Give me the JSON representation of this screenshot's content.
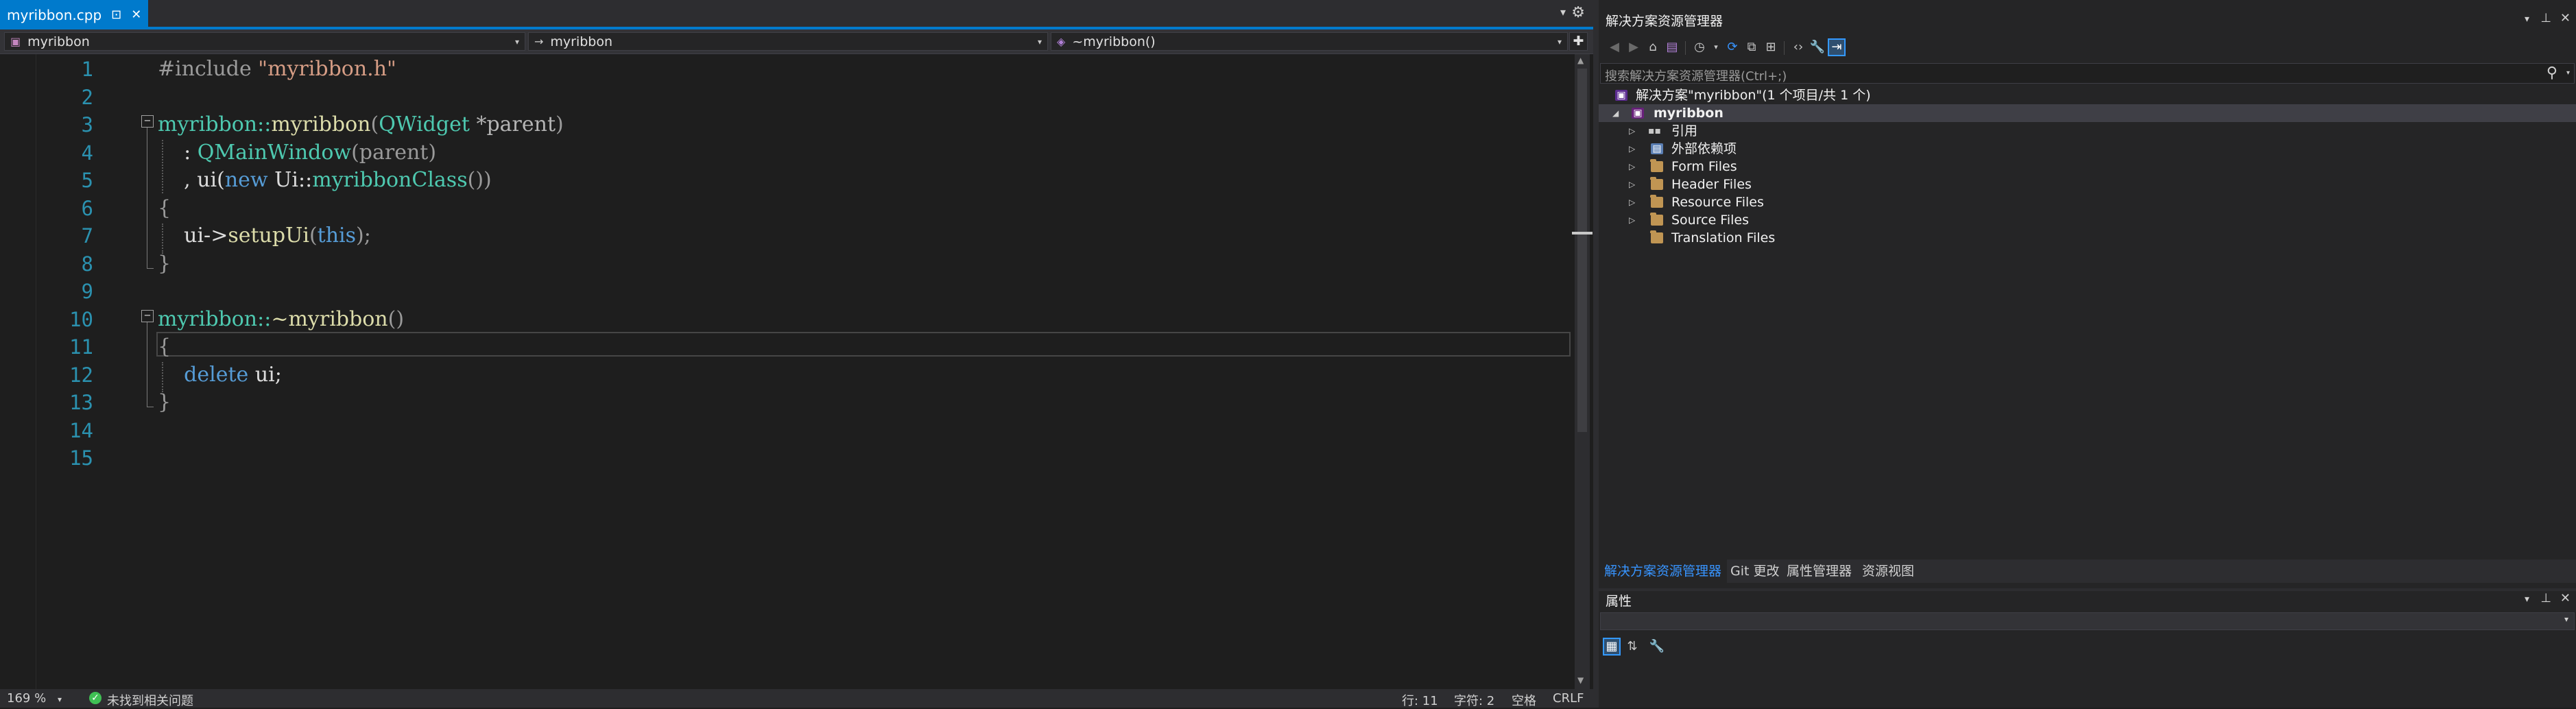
{
  "editor": {
    "tab_title": "myribbon.cpp",
    "tab_pin_glyph": "⊡",
    "tab_close_glyph": "✕",
    "tab_dropdown_glyph": "▾",
    "settings_glyph": "⚙",
    "nav": {
      "scope": "myribbon",
      "member_class": "myribbon",
      "member_function": "~myribbon()",
      "split_glyph": "✚"
    },
    "line_numbers": [
      "1",
      "2",
      "3",
      "4",
      "5",
      "6",
      "7",
      "8",
      "9",
      "10",
      "11",
      "12",
      "13",
      "14",
      "15"
    ],
    "code": {
      "l1_pp": "#include ",
      "l1_str": "\"myribbon.h\"",
      "l3_a": "myribbon::",
      "l3_fn": "myribbon",
      "l3_paren": "(",
      "l3_cls": "QWidget",
      "l3_rest": " *parent",
      "l3_close": ")",
      "l4_a": "    : ",
      "l4_cls": "QMainWindow",
      "l4_rest": "(parent)",
      "l5_a": "    , ui(",
      "l5_kw": "new",
      "l5_b": " Ui::",
      "l5_cls": "myribbonClass",
      "l5_c": "())",
      "l6": "{",
      "l7_a": "    ui->",
      "l7_fn": "setupUi",
      "l7_b": "(",
      "l7_kw": "this",
      "l7_c": ");",
      "l8": "}",
      "l10_a": "myribbon::",
      "l10_fn": "~myribbon",
      "l10_b": "()",
      "l11": "{",
      "l12_a": "    ",
      "l12_kw": "delete",
      "l12_b": " ui;",
      "l13": "}"
    },
    "status": {
      "zoom": "169 %",
      "issues": "未找到相关问题",
      "line": "行: 11",
      "col": "字符: 2",
      "whitespace": "空格",
      "eol": "CRLF"
    }
  },
  "solution_explorer": {
    "title": "解决方案资源管理器",
    "search_placeholder": "搜索解决方案资源管理器(Ctrl+;)",
    "solution_label": "解决方案\"myribbon\"(1 个项目/共 1 个)",
    "project_label": "myribbon",
    "items": [
      {
        "label": "引用"
      },
      {
        "label": "外部依赖项"
      },
      {
        "label": "Form Files"
      },
      {
        "label": "Header Files"
      },
      {
        "label": "Resource Files"
      },
      {
        "label": "Source Files"
      },
      {
        "label": "Translation Files"
      }
    ],
    "tabs": [
      "解决方案资源管理器",
      "Git 更改",
      "属性管理器",
      "资源视图"
    ]
  },
  "properties": {
    "title": "属性"
  },
  "colors": {
    "accent": "#007acc",
    "editor_bg": "#1e1e1e",
    "panel_bg": "#252526"
  }
}
